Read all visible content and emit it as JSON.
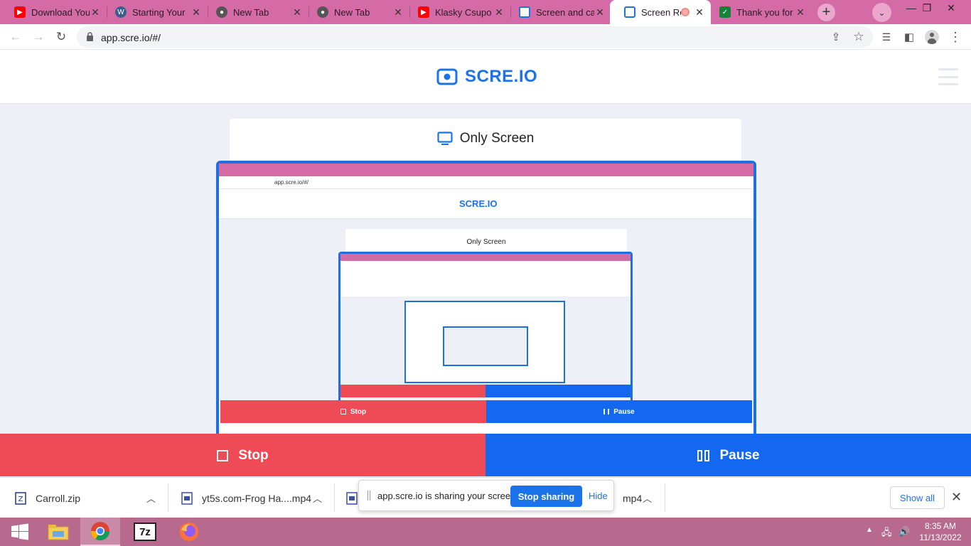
{
  "browser": {
    "tabs": [
      {
        "title": "Download You",
        "favicon": "youtube-icon",
        "color": "#ff0000"
      },
      {
        "title": "Starting Your",
        "favicon": "wordpress-icon",
        "color": "#3a5f8a"
      },
      {
        "title": "New Tab",
        "favicon": "chrome-icon",
        "color": "#444444"
      },
      {
        "title": "New Tab",
        "favicon": "chrome-icon",
        "color": "#444444"
      },
      {
        "title": "Klasky Csupo",
        "favicon": "youtube-icon",
        "color": "#ff0000"
      },
      {
        "title": "Screen and ca",
        "favicon": "screen-icon",
        "color": "#1a73e8"
      },
      {
        "title": "Screen Re",
        "favicon": "screen-icon",
        "color": "#1a73e8",
        "active": true
      },
      {
        "title": "Thank you for",
        "favicon": "sheets-icon",
        "color": "#188038"
      }
    ],
    "url": "app.scre.io/#/"
  },
  "site": {
    "brand": "SCRE.IO",
    "mode_title": "Only Screen",
    "stop_label": "Stop",
    "pause_label": "Pause"
  },
  "preview": {
    "url": "app.scre.io/#/",
    "brand": "SCRE.IO",
    "mode_title": "Only Screen",
    "stop_label": "Stop",
    "pause_label": "Pause"
  },
  "downloads": {
    "items": [
      {
        "name": "Carroll.zip",
        "icon": "zip-file-icon"
      },
      {
        "name": "yt5s.com-Frog Ha....mp4",
        "icon": "video-file-icon"
      },
      {
        "name": "mp4",
        "icon": "video-file-icon"
      }
    ],
    "show_all": "Show all"
  },
  "share_notice": {
    "message": "app.scre.io is sharing your screen.",
    "stop_label": "Stop sharing",
    "hide_label": "Hide"
  },
  "taskbar": {
    "time": "8:35 AM",
    "date": "11/13/2022"
  },
  "colors": {
    "accent": "#1a73e8",
    "stop_red": "#ef4b56",
    "pause_blue": "#1468f0",
    "tab_strip": "#d56ba6"
  }
}
